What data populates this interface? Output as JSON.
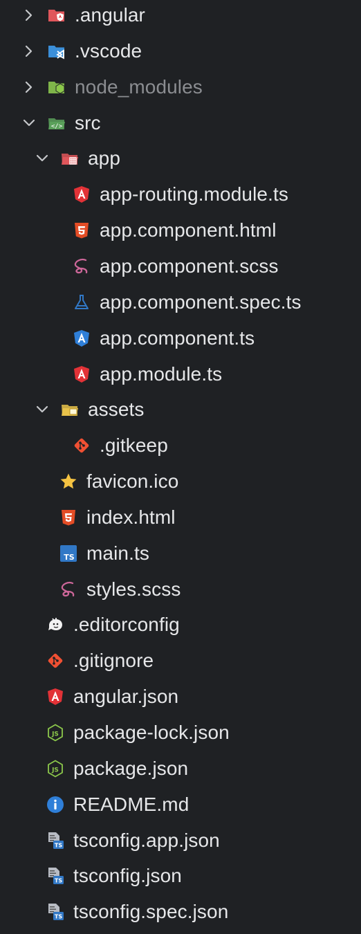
{
  "colors": {
    "background": "#1f2124",
    "text": "#e6e7e9",
    "text_dim": "#8b8d91",
    "chevron": "#c5c7ca",
    "angular_red": "#e23237",
    "angular_blue": "#2f7fd8",
    "html_orange": "#e44d26",
    "sass_pink": "#cd6799",
    "ts_blue": "#3178c6",
    "node_green": "#8cc84b",
    "git_orange": "#f05033",
    "folder_yellow": "#e8c24a",
    "info_blue": "#2f7fd8"
  },
  "explorer": {
    "items": [
      {
        "label": ".angular",
        "depth": 0,
        "chevron": "right",
        "icon": "angular-folder-icon"
      },
      {
        "label": ".vscode",
        "depth": 0,
        "chevron": "right",
        "icon": "vscode-folder-icon"
      },
      {
        "label": "node_modules",
        "depth": 0,
        "chevron": "right",
        "icon": "node-folder-icon",
        "dim": true
      },
      {
        "label": "src",
        "depth": 0,
        "chevron": "down",
        "icon": "src-folder-open-icon"
      },
      {
        "label": "app",
        "depth": 1,
        "chevron": "down",
        "icon": "app-folder-open-icon"
      },
      {
        "label": "app-routing.module.ts",
        "depth": 2,
        "chevron": "none",
        "icon": "angular-icon"
      },
      {
        "label": "app.component.html",
        "depth": 2,
        "chevron": "none",
        "icon": "html5-icon"
      },
      {
        "label": "app.component.scss",
        "depth": 2,
        "chevron": "none",
        "icon": "sass-icon"
      },
      {
        "label": "app.component.spec.ts",
        "depth": 2,
        "chevron": "none",
        "icon": "test-flask-icon"
      },
      {
        "label": "app.component.ts",
        "depth": 2,
        "chevron": "none",
        "icon": "angular-component-icon"
      },
      {
        "label": "app.module.ts",
        "depth": 2,
        "chevron": "none",
        "icon": "angular-icon"
      },
      {
        "label": "assets",
        "depth": 1,
        "chevron": "down",
        "icon": "assets-folder-open-icon"
      },
      {
        "label": ".gitkeep",
        "depth": 2,
        "chevron": "none",
        "icon": "git-icon"
      },
      {
        "label": "favicon.ico",
        "depth": 1,
        "chevron": "none",
        "icon": "star-icon"
      },
      {
        "label": "index.html",
        "depth": 1,
        "chevron": "none",
        "icon": "html5-icon"
      },
      {
        "label": "main.ts",
        "depth": 1,
        "chevron": "none",
        "icon": "typescript-icon"
      },
      {
        "label": "styles.scss",
        "depth": 1,
        "chevron": "none",
        "icon": "sass-icon"
      },
      {
        "label": ".editorconfig",
        "depth": 0,
        "chevron": "none",
        "icon": "editorconfig-icon"
      },
      {
        "label": ".gitignore",
        "depth": 0,
        "chevron": "none",
        "icon": "git-icon"
      },
      {
        "label": "angular.json",
        "depth": 0,
        "chevron": "none",
        "icon": "angular-icon"
      },
      {
        "label": "package-lock.json",
        "depth": 0,
        "chevron": "none",
        "icon": "nodejs-icon"
      },
      {
        "label": "package.json",
        "depth": 0,
        "chevron": "none",
        "icon": "nodejs-icon"
      },
      {
        "label": "README.md",
        "depth": 0,
        "chevron": "none",
        "icon": "info-icon"
      },
      {
        "label": "tsconfig.app.json",
        "depth": 0,
        "chevron": "none",
        "icon": "tsconfig-icon"
      },
      {
        "label": "tsconfig.json",
        "depth": 0,
        "chevron": "none",
        "icon": "tsconfig-icon"
      },
      {
        "label": "tsconfig.spec.json",
        "depth": 0,
        "chevron": "none",
        "icon": "tsconfig-icon"
      }
    ]
  }
}
